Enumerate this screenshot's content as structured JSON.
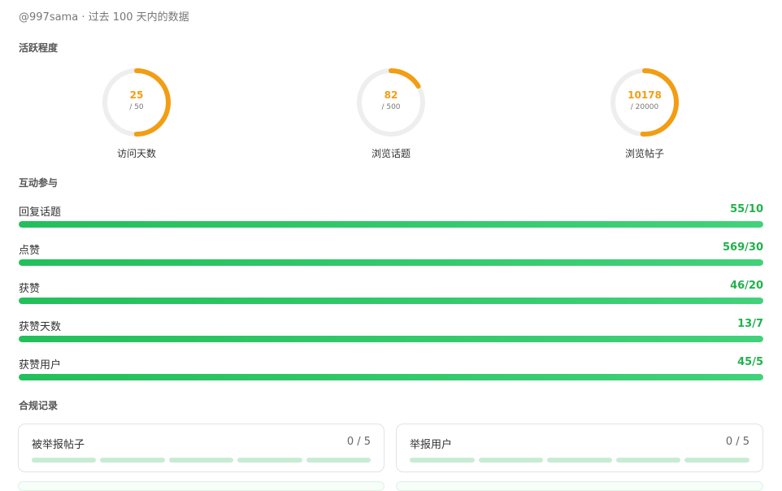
{
  "header": {
    "subtitle": "@997sama · 过去 100 天内的数据"
  },
  "sections": {
    "activity": "活跃程度",
    "engagement": "互动参与",
    "compliance": "合规记录"
  },
  "activity_rings": [
    {
      "value": "25",
      "goal": "/ 50",
      "label": "访问天数",
      "progress": 0.5
    },
    {
      "value": "82",
      "goal": "/ 500",
      "label": "浏览话题",
      "progress": 0.164
    },
    {
      "value": "10178",
      "goal": "/ 20000",
      "label": "浏览帖子",
      "progress": 0.5089
    }
  ],
  "engagement_bars": [
    {
      "label": "回复话题",
      "value": "55/10",
      "progress": 1.0
    },
    {
      "label": "点赞",
      "value": "569/30",
      "progress": 1.0
    },
    {
      "label": "获赞",
      "value": "46/20",
      "progress": 1.0
    },
    {
      "label": "获赞天数",
      "value": "13/7",
      "progress": 1.0
    },
    {
      "label": "获赞用户",
      "value": "45/5",
      "progress": 1.0
    }
  ],
  "compliance_cards": [
    {
      "label": "被举报帖子",
      "value": "0 / 5",
      "segments": 5,
      "filled": 0
    },
    {
      "label": "举报用户",
      "value": "0 / 5",
      "segments": 5,
      "filled": 0
    }
  ],
  "colors": {
    "ring_accent": "#f29d13",
    "ring_track": "#eeeeee",
    "bar_fill": "#22c05a",
    "bar_value": "#22b14c",
    "segment_empty": "#c8ecd3"
  }
}
